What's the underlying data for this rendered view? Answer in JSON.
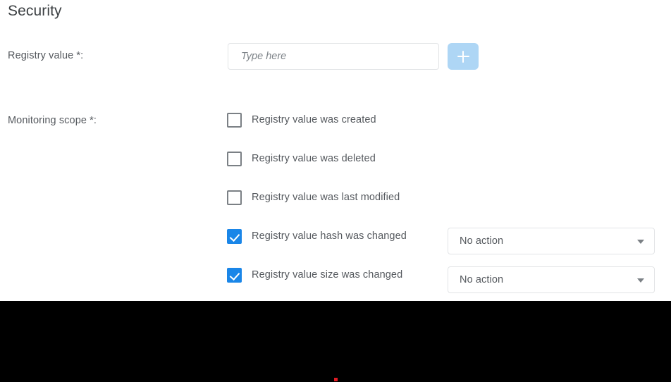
{
  "page": {
    "title": "Security"
  },
  "colors": {
    "accent_blue": "#1a86e8",
    "add_button_blue": "#aed6f5",
    "label_gray": "#55595e",
    "border_gray": "#e2e4e6",
    "checkbox_border": "#7b8085",
    "cursor_red": "#e01b24",
    "black_region": "#000000"
  },
  "registry_value_field": {
    "label": "Registry value *:",
    "value": "",
    "placeholder": "Type here",
    "add_button_label": "+",
    "add_button_icon": "plus-icon"
  },
  "monitoring_scope": {
    "label": "Monitoring scope *:",
    "items": [
      {
        "label": "Registry value was created",
        "checked": false,
        "has_action": false,
        "action": null
      },
      {
        "label": "Registry value was deleted",
        "checked": false,
        "has_action": false,
        "action": null
      },
      {
        "label": "Registry value was last modified",
        "checked": false,
        "has_action": false,
        "action": null
      },
      {
        "label": "Registry value hash was changed",
        "checked": true,
        "has_action": true,
        "action": "No action"
      },
      {
        "label": "Registry value size was changed",
        "checked": true,
        "has_action": true,
        "action": "No action"
      }
    ]
  }
}
